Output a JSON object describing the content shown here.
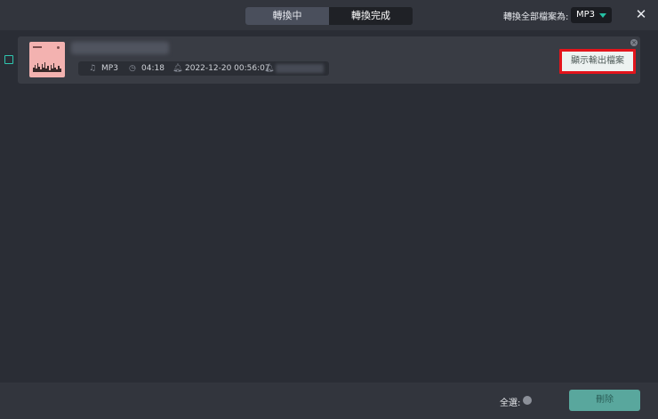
{
  "header": {
    "tabs": [
      {
        "label": "轉換中"
      },
      {
        "label": "轉換完成"
      }
    ],
    "convert_all_label": "轉換全部檔案為:",
    "format_value": "MP3",
    "close_icon": "close-icon"
  },
  "item": {
    "format": "MP3",
    "duration": "04:18",
    "datetime": "2022-12-20 00:56:07",
    "show_output_label": "顯示輸出檔案",
    "icons": {
      "format": "music-note-icon",
      "duration": "clock-icon",
      "date": "bell-icon",
      "extra": "bell-icon"
    }
  },
  "footer": {
    "select_all_label": "全選:",
    "delete_label": "刪除"
  },
  "colors": {
    "accent": "#25c0a3",
    "highlight": "#e3141b",
    "delete_button": "#59a79d"
  }
}
